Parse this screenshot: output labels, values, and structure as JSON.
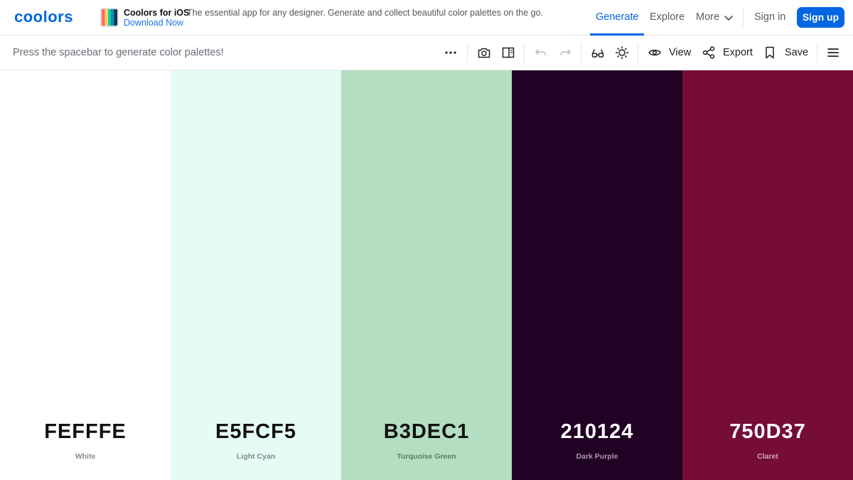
{
  "nav": {
    "logo_text": "coolors",
    "promo": {
      "title": "Coolors for iOS",
      "description": "The essential app for any designer. Generate and collect beautiful color palettes on the go.",
      "link": "Download Now"
    },
    "links": {
      "generate": "Generate",
      "explore": "Explore",
      "more": "More",
      "sign_in": "Sign in",
      "sign_up": "Sign up"
    },
    "accent_color": "#0066e4"
  },
  "toolbar": {
    "hint": "Press the spacebar to generate color palettes!",
    "icons": [
      "more-horizontal-icon",
      "camera-icon",
      "sidebar-panel-icon",
      "undo-icon",
      "redo-icon",
      "glasses-icon",
      "sun-icon",
      "eye-icon",
      "share-icon",
      "bookmark-icon",
      "hamburger-menu-icon"
    ],
    "view_label": "View",
    "export_label": "Export",
    "save_label": "Save"
  },
  "palette": [
    {
      "hex": "FEFFFE",
      "name": "White",
      "color": "#FEFFFE",
      "text_color": "#111111",
      "name_color": "#8a8a8a"
    },
    {
      "hex": "E5FCF5",
      "name": "Light Cyan",
      "color": "#E5FCF5",
      "text_color": "#111111",
      "name_color": "#7d8a86"
    },
    {
      "hex": "B3DEC1",
      "name": "Turquoise Green",
      "color": "#B3DEC1",
      "text_color": "#111111",
      "name_color": "#5f7a68"
    },
    {
      "hex": "210124",
      "name": "Dark Purple",
      "color": "#210124",
      "text_color": "#ffffff",
      "name_color": "#a99aab"
    },
    {
      "hex": "750D37",
      "name": "Claret",
      "color": "#750D37",
      "text_color": "#ffffff",
      "name_color": "#d3a9b9"
    }
  ]
}
